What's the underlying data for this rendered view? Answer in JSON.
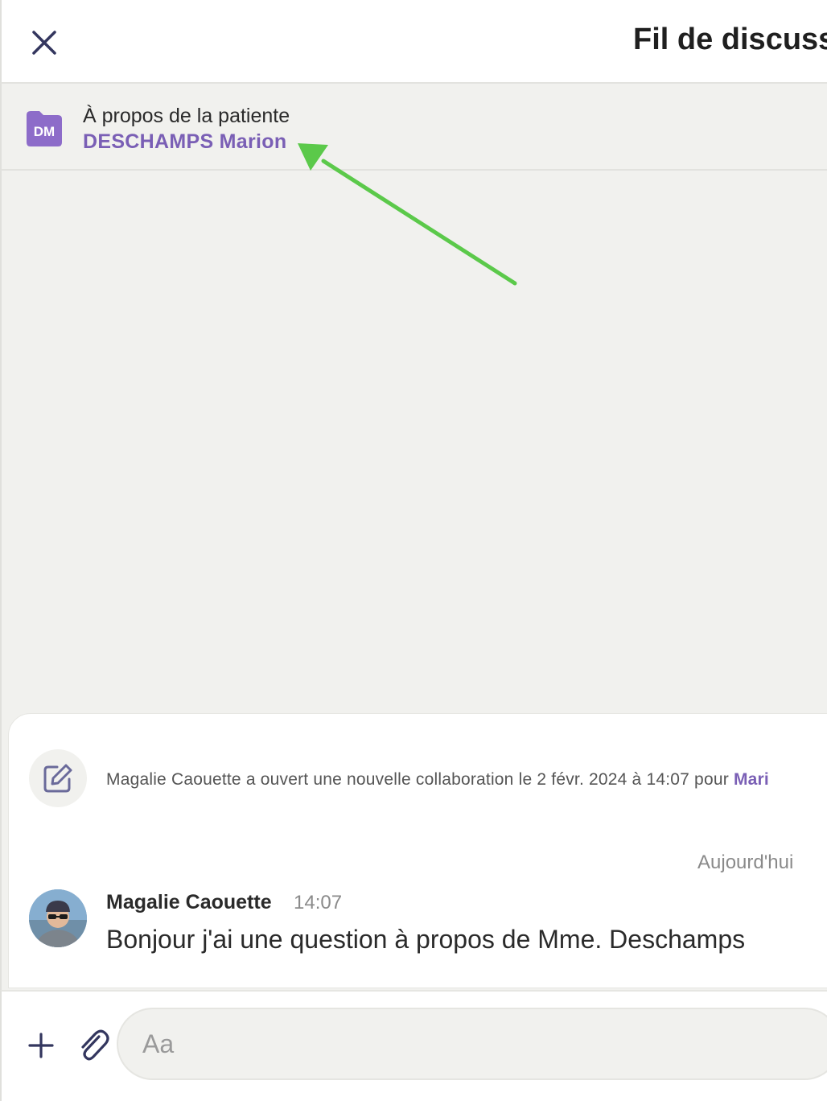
{
  "header": {
    "title": "Fil de discussi",
    "close_icon": "close-icon"
  },
  "patient": {
    "label": "À propos de la patiente",
    "name": "DESCHAMPS Marion",
    "initials": "DM",
    "accent": "#8d6cc9",
    "icon": "folder-icon"
  },
  "annotation": {
    "arrow_color": "#5bc94a"
  },
  "thread": {
    "system_event": {
      "icon": "edit-note-icon",
      "text": "Magalie Caouette a ouvert une nouvelle collaboration le 2 févr. 2024 à 14:07 pour ",
      "link": "Mari"
    },
    "day_separator": "Aujourd'hui",
    "messages": [
      {
        "author": "Magalie Caouette",
        "time": "14:07",
        "body": "Bonjour j'ai une question à propos de Mme. Deschamps",
        "avatar": "user-avatar"
      }
    ]
  },
  "composer": {
    "placeholder": "Aa",
    "add_icon": "plus-icon",
    "attach_icon": "paperclip-icon"
  }
}
